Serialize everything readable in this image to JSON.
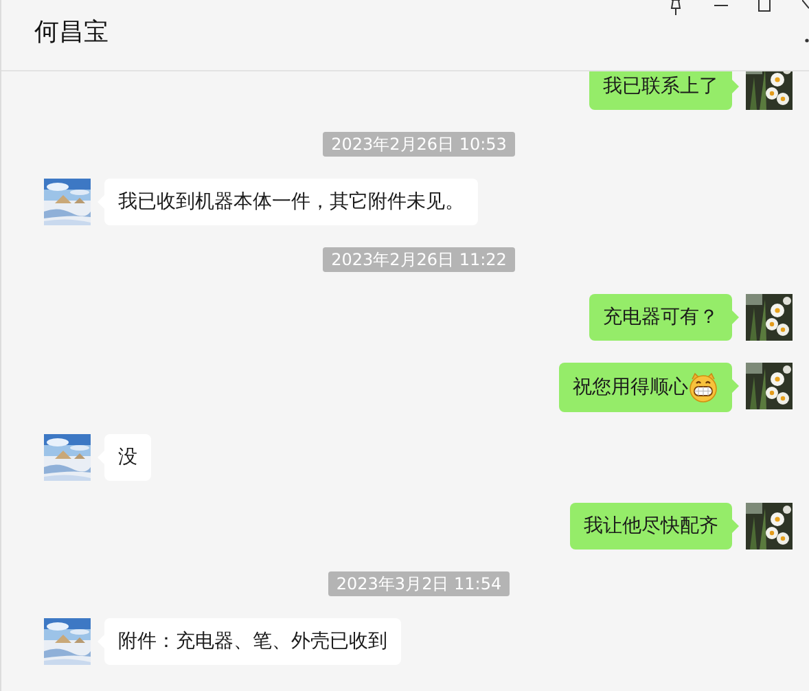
{
  "window": {
    "title": "何昌宝"
  },
  "messages": [
    {
      "kind": "out",
      "text": "我已联系上了"
    },
    {
      "kind": "time",
      "text": "2023年2月26日 10:53"
    },
    {
      "kind": "in",
      "text": "我已收到机器本体一件，其它附件未见。"
    },
    {
      "kind": "time",
      "text": "2023年2月26日 11:22"
    },
    {
      "kind": "out",
      "text": "充电器可有？"
    },
    {
      "kind": "out",
      "text": "祝您用得顺心",
      "emoji": true
    },
    {
      "kind": "in",
      "text": "没"
    },
    {
      "kind": "out",
      "text": "我让他尽快配齐"
    },
    {
      "kind": "time",
      "text": "2023年3月2日 11:54"
    },
    {
      "kind": "in",
      "text": "附件：充电器、笔、外壳已收到"
    }
  ]
}
